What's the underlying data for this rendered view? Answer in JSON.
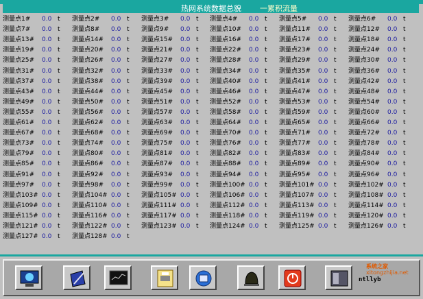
{
  "title": {
    "main": "热网系统数据总貌",
    "sub": "一累积流量"
  },
  "cells": [
    {
      "label": "测量点1#",
      "value": "0.0",
      "unit": "t"
    },
    {
      "label": "测量点2#",
      "value": "0.0",
      "unit": "t"
    },
    {
      "label": "测量点3#",
      "value": "0.0",
      "unit": "t"
    },
    {
      "label": "测量点4#",
      "value": "0.0",
      "unit": "t"
    },
    {
      "label": "测量点5#",
      "value": "0.0",
      "unit": "t"
    },
    {
      "label": "测量点6#",
      "value": "0.0",
      "unit": "t"
    },
    {
      "label": "测量点7#",
      "value": "0.0",
      "unit": "t"
    },
    {
      "label": "测量点8#",
      "value": "0.0",
      "unit": "t"
    },
    {
      "label": "测量点9#",
      "value": "0.0",
      "unit": "t"
    },
    {
      "label": "测量点10#",
      "value": "0.0",
      "unit": "t"
    },
    {
      "label": "测量点11#",
      "value": "0.0",
      "unit": "t"
    },
    {
      "label": "测量点12#",
      "value": "0.0",
      "unit": "t"
    },
    {
      "label": "测量点13#",
      "value": "0.0",
      "unit": "t"
    },
    {
      "label": "测量点14#",
      "value": "0.0",
      "unit": "t"
    },
    {
      "label": "测量点15#",
      "value": "0.0",
      "unit": "t"
    },
    {
      "label": "测量点16#",
      "value": "0.0",
      "unit": "t"
    },
    {
      "label": "测量点17#",
      "value": "0.0",
      "unit": "t"
    },
    {
      "label": "测量点18#",
      "value": "0.0",
      "unit": "t"
    },
    {
      "label": "测量点19#",
      "value": "0.0",
      "unit": "t"
    },
    {
      "label": "测量点20#",
      "value": "0.0",
      "unit": "t"
    },
    {
      "label": "测量点21#",
      "value": "0.0",
      "unit": "t"
    },
    {
      "label": "测量点22#",
      "value": "0.0",
      "unit": "t"
    },
    {
      "label": "测量点23#",
      "value": "0.0",
      "unit": "t"
    },
    {
      "label": "测量点24#",
      "value": "0.0",
      "unit": "t"
    },
    {
      "label": "测量点25#",
      "value": "0.0",
      "unit": "t"
    },
    {
      "label": "测量点26#",
      "value": "0.0",
      "unit": "t"
    },
    {
      "label": "测量点27#",
      "value": "0.0",
      "unit": "t"
    },
    {
      "label": "测量点28#",
      "value": "0.0",
      "unit": "t"
    },
    {
      "label": "测量点29#",
      "value": "0.0",
      "unit": "t"
    },
    {
      "label": "测量点30#",
      "value": "0.0",
      "unit": "t"
    },
    {
      "label": "测量点31#",
      "value": "0.0",
      "unit": "t"
    },
    {
      "label": "测量点32#",
      "value": "0.0",
      "unit": "t"
    },
    {
      "label": "测量点33#",
      "value": "0.0",
      "unit": "t"
    },
    {
      "label": "测量点34#",
      "value": "0.0",
      "unit": "t"
    },
    {
      "label": "测量点35#",
      "value": "0.0",
      "unit": "t"
    },
    {
      "label": "测量点36#",
      "value": "0.0",
      "unit": "t"
    },
    {
      "label": "测量点37#",
      "value": "0.0",
      "unit": "t"
    },
    {
      "label": "测量点38#",
      "value": "0.0",
      "unit": "t"
    },
    {
      "label": "测量点39#",
      "value": "0.0",
      "unit": "t"
    },
    {
      "label": "测量点40#",
      "value": "0.0",
      "unit": "t"
    },
    {
      "label": "测量点41#",
      "value": "0.0",
      "unit": "t"
    },
    {
      "label": "测量点42#",
      "value": "0.0",
      "unit": "t"
    },
    {
      "label": "测量点43#",
      "value": "0.0",
      "unit": "t"
    },
    {
      "label": "测量点44#",
      "value": "0.0",
      "unit": "t"
    },
    {
      "label": "测量点45#",
      "value": "0.0",
      "unit": "t"
    },
    {
      "label": "测量点46#",
      "value": "0.0",
      "unit": "t"
    },
    {
      "label": "测量点47#",
      "value": "0.0",
      "unit": "t"
    },
    {
      "label": "测量点48#",
      "value": "0.0",
      "unit": "t"
    },
    {
      "label": "测量点49#",
      "value": "0.0",
      "unit": "t"
    },
    {
      "label": "测量点50#",
      "value": "0.0",
      "unit": "t"
    },
    {
      "label": "测量点51#",
      "value": "0.0",
      "unit": "t"
    },
    {
      "label": "测量点52#",
      "value": "0.0",
      "unit": "t"
    },
    {
      "label": "测量点53#",
      "value": "0.0",
      "unit": "t"
    },
    {
      "label": "测量点54#",
      "value": "0.0",
      "unit": "t"
    },
    {
      "label": "测量点55#",
      "value": "0.0",
      "unit": "t"
    },
    {
      "label": "测量点56#",
      "value": "0.0",
      "unit": "t"
    },
    {
      "label": "测量点57#",
      "value": "0.0",
      "unit": "t"
    },
    {
      "label": "测量点58#",
      "value": "0.0",
      "unit": "t"
    },
    {
      "label": "测量点59#",
      "value": "0.0",
      "unit": "t"
    },
    {
      "label": "测量点60#",
      "value": "0.0",
      "unit": "t"
    },
    {
      "label": "测量点61#",
      "value": "0.0",
      "unit": "t"
    },
    {
      "label": "测量点62#",
      "value": "0.0",
      "unit": "t"
    },
    {
      "label": "测量点63#",
      "value": "0.0",
      "unit": "t"
    },
    {
      "label": "测量点64#",
      "value": "0.0",
      "unit": "t"
    },
    {
      "label": "测量点65#",
      "value": "0.0",
      "unit": "t"
    },
    {
      "label": "测量点66#",
      "value": "0.0",
      "unit": "t"
    },
    {
      "label": "测量点67#",
      "value": "0.0",
      "unit": "t"
    },
    {
      "label": "测量点68#",
      "value": "0.0",
      "unit": "t"
    },
    {
      "label": "测量点69#",
      "value": "0.0",
      "unit": "t"
    },
    {
      "label": "测量点70#",
      "value": "0.0",
      "unit": "t"
    },
    {
      "label": "测量点71#",
      "value": "0.0",
      "unit": "t"
    },
    {
      "label": "测量点72#",
      "value": "0.0",
      "unit": "t"
    },
    {
      "label": "测量点73#",
      "value": "0.0",
      "unit": "t"
    },
    {
      "label": "测量点74#",
      "value": "0.0",
      "unit": "t"
    },
    {
      "label": "测量点75#",
      "value": "0.0",
      "unit": "t"
    },
    {
      "label": "测量点76#",
      "value": "0.0",
      "unit": "t"
    },
    {
      "label": "测量点77#",
      "value": "0.0",
      "unit": "t"
    },
    {
      "label": "测量点78#",
      "value": "0.0",
      "unit": "t"
    },
    {
      "label": "测量点79#",
      "value": "0.0",
      "unit": "t"
    },
    {
      "label": "测量点80#",
      "value": "0.0",
      "unit": "t"
    },
    {
      "label": "测量点81#",
      "value": "0.0",
      "unit": "t"
    },
    {
      "label": "测量点82#",
      "value": "0.0",
      "unit": "t"
    },
    {
      "label": "测量点83#",
      "value": "0.0",
      "unit": "t"
    },
    {
      "label": "测量点84#",
      "value": "0.0",
      "unit": "t"
    },
    {
      "label": "测量点85#",
      "value": "0.0",
      "unit": "t"
    },
    {
      "label": "测量点86#",
      "value": "0.0",
      "unit": "t"
    },
    {
      "label": "测量点87#",
      "value": "0.0",
      "unit": "t"
    },
    {
      "label": "测量点88#",
      "value": "0.0",
      "unit": "t"
    },
    {
      "label": "测量点89#",
      "value": "0.0",
      "unit": "t"
    },
    {
      "label": "测量点90#",
      "value": "0.0",
      "unit": "t"
    },
    {
      "label": "测量点91#",
      "value": "0.0",
      "unit": "t"
    },
    {
      "label": "测量点92#",
      "value": "0.0",
      "unit": "t"
    },
    {
      "label": "测量点93#",
      "value": "0.0",
      "unit": "t"
    },
    {
      "label": "测量点94#",
      "value": "0.0",
      "unit": "t"
    },
    {
      "label": "测量点95#",
      "value": "0.0",
      "unit": "t"
    },
    {
      "label": "测量点96#",
      "value": "0.0",
      "unit": "t"
    },
    {
      "label": "测量点97#",
      "value": "0.0",
      "unit": "t"
    },
    {
      "label": "测量点98#",
      "value": "0.0",
      "unit": "t"
    },
    {
      "label": "测量点99#",
      "value": "0.0",
      "unit": "t"
    },
    {
      "label": "测量点100#",
      "value": "0.0",
      "unit": "t"
    },
    {
      "label": "测量点101#",
      "value": "0.0",
      "unit": "t"
    },
    {
      "label": "测量点102#",
      "value": "0.0",
      "unit": "t"
    },
    {
      "label": "测量点103#",
      "value": "0.0",
      "unit": "t"
    },
    {
      "label": "测量点104#",
      "value": "0.0",
      "unit": "t"
    },
    {
      "label": "测量点105#",
      "value": "0.0",
      "unit": "t"
    },
    {
      "label": "测量点106#",
      "value": "0.0",
      "unit": "t"
    },
    {
      "label": "测量点107#",
      "value": "0.0",
      "unit": "t"
    },
    {
      "label": "测量点108#",
      "value": "0.0",
      "unit": "t"
    },
    {
      "label": "测量点109#",
      "value": "0.0",
      "unit": "t"
    },
    {
      "label": "测量点110#",
      "value": "0.0",
      "unit": "t"
    },
    {
      "label": "测量点111#",
      "value": "0.0",
      "unit": "t"
    },
    {
      "label": "测量点112#",
      "value": "0.0",
      "unit": "t"
    },
    {
      "label": "测量点113#",
      "value": "0.0",
      "unit": "t"
    },
    {
      "label": "测量点114#",
      "value": "0.0",
      "unit": "t"
    },
    {
      "label": "测量点115#",
      "value": "0.0",
      "unit": "t"
    },
    {
      "label": "测量点116#",
      "value": "0.0",
      "unit": "t"
    },
    {
      "label": "测量点117#",
      "value": "0.0",
      "unit": "t"
    },
    {
      "label": "测量点118#",
      "value": "0.0",
      "unit": "t"
    },
    {
      "label": "测量点119#",
      "value": "0.0",
      "unit": "t"
    },
    {
      "label": "测量点120#",
      "value": "0.0",
      "unit": "t"
    },
    {
      "label": "测量点121#",
      "value": "0.0",
      "unit": "t"
    },
    {
      "label": "测量点122#",
      "value": "0.0",
      "unit": "t"
    },
    {
      "label": "测量点123#",
      "value": "0.0",
      "unit": "t"
    },
    {
      "label": "测量点124#",
      "value": "0.0",
      "unit": "t"
    },
    {
      "label": "测量点125#",
      "value": "0.0",
      "unit": "t"
    },
    {
      "label": "测量点126#",
      "value": "0.0",
      "unit": "t"
    },
    {
      "label": "测量点127#",
      "value": "0.0",
      "unit": "t"
    },
    {
      "label": "测量点128#",
      "value": "0.0",
      "unit": "t"
    }
  ],
  "toolbar": {
    "buttons": [
      {
        "icon": "monitor-globe-icon"
      },
      {
        "icon": "document-pen-icon"
      },
      {
        "icon": "trend-screen-icon"
      },
      {
        "icon": "printer-icon"
      },
      {
        "icon": "network-globe-icon"
      },
      {
        "icon": "alarm-bell-icon"
      },
      {
        "icon": "power-icon"
      },
      {
        "icon": "exit-door-icon"
      }
    ],
    "brand": "ntllyb"
  },
  "watermark": {
    "line1": "系统之家",
    "line2": "xitongzhijia.net"
  },
  "colors": {
    "title_bg": "#1aa7a0",
    "value_text": "#1a1aa0",
    "panel_bg": "#c0c0c0"
  }
}
